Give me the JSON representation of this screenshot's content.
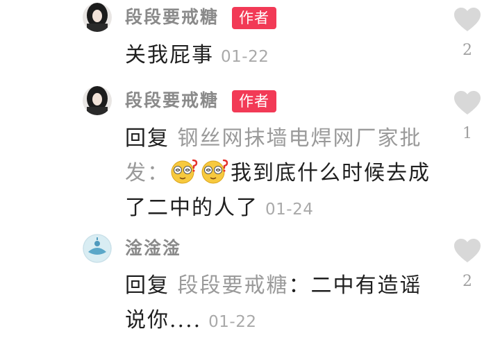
{
  "comments": [
    {
      "author": "段段要戒糖",
      "badge": "作者",
      "text": "关我屁事",
      "time": "01-22",
      "like_count": "2"
    },
    {
      "author": "段段要戒糖",
      "badge": "作者",
      "reply_word": "回复",
      "reply_target": "钢丝网抹墙电焊网厂家批发",
      "separator": "：",
      "text": "我到底什么时候去成了二中的人了",
      "time": "01-24",
      "like_count": "1"
    },
    {
      "author": "淦淦淦",
      "reply_word": "回复",
      "reply_target": "段段要戒糖",
      "separator": "：",
      "text": "二中有造谣说你....",
      "time": "01-22",
      "like_count": "2"
    }
  ],
  "icons": {
    "like": "heart-icon",
    "emoji": "confused-face-emoji"
  },
  "colors": {
    "badge": "#f23a56",
    "heart": "#d8d8d8",
    "name": "#8a8a8a"
  }
}
